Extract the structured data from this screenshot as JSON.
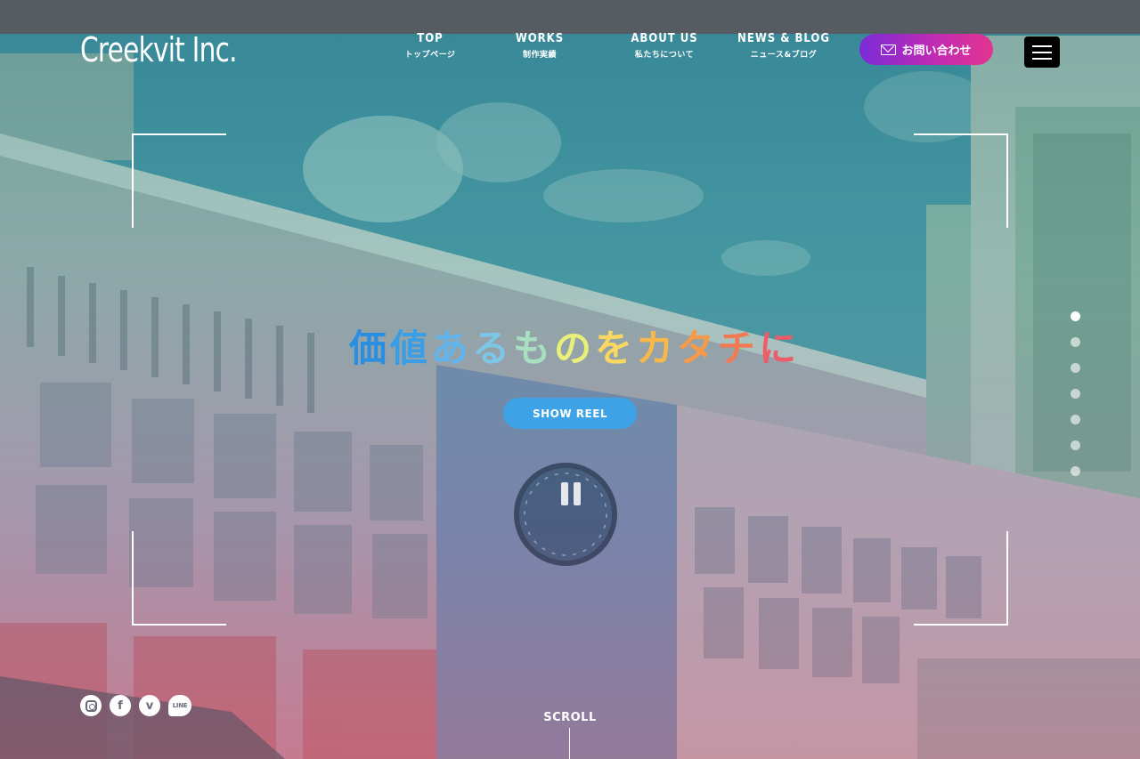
{
  "header": {
    "logo": "Creekvit Inc.",
    "nav": [
      {
        "en": "TOP",
        "ja": "トップページ"
      },
      {
        "en": "WORKS",
        "ja": "制作実績"
      },
      {
        "en": "ABOUT US",
        "ja": "私たちについて"
      },
      {
        "en": "NEWS & BLOG",
        "ja": "ニュース&ブログ"
      }
    ],
    "contact_label": "お問い合わせ"
  },
  "hero": {
    "headline": [
      "価",
      "値",
      "あ",
      "る",
      "も",
      "の",
      "を",
      "カ",
      "タ",
      "チ",
      "に"
    ],
    "headline_colors": [
      "#2a8fe0",
      "#3a9ee6",
      "#62b5ec",
      "#7cc6e8",
      "#a6e0c0",
      "#e8f07a",
      "#f8d860",
      "#f8b84a",
      "#f59a48",
      "#f27a52",
      "#ee5c68"
    ],
    "reel_button": "SHOW REEL",
    "slide_count": 7,
    "active_slide": 1
  },
  "social": [
    "instagram-icon",
    "facebook-icon",
    "vimeo-icon",
    "line-icon"
  ],
  "social_text": {
    "facebook": "f",
    "vimeo": "v",
    "line": "LINE"
  },
  "scroll_label": "SCROLL"
}
